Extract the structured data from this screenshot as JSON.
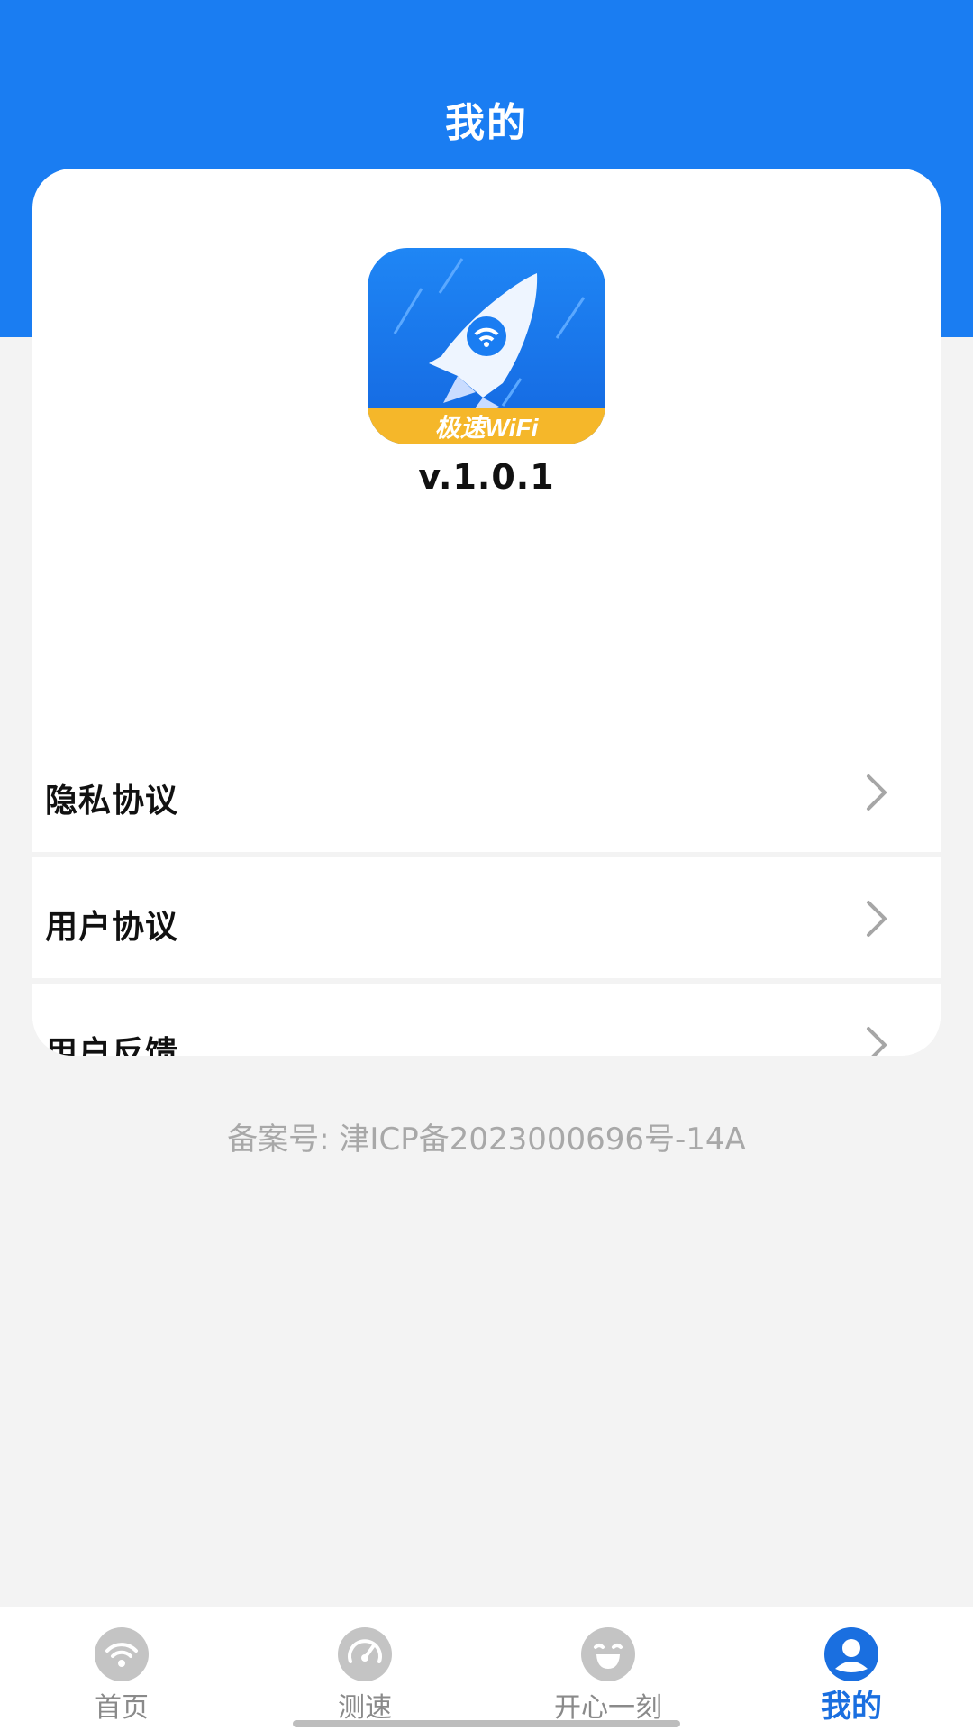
{
  "header": {
    "title": "我的"
  },
  "app": {
    "version": "v.1.0.1",
    "logo_text": "极速WiFi"
  },
  "menu": {
    "items": [
      {
        "label": "隐私协议",
        "icon": "chevron-right-icon"
      },
      {
        "label": "用户协议",
        "icon": "chevron-right-icon"
      },
      {
        "label": "用户反馈",
        "icon": "chevron-right-icon"
      }
    ]
  },
  "footer": {
    "icp": "备案号: 津ICP备2023000696号-14A"
  },
  "tabbar": {
    "active_index": 3,
    "items": [
      {
        "label": "首页",
        "icon": "wifi-icon"
      },
      {
        "label": "测速",
        "icon": "speedometer-icon"
      },
      {
        "label": "开心一刻",
        "icon": "laugh-face-icon"
      },
      {
        "label": "我的",
        "icon": "user-icon"
      }
    ]
  },
  "colors": {
    "primary": "#1a7df2",
    "active_tab": "#1a6fe0",
    "inactive_icon": "#c4c4c4",
    "logo_band": "#f5b72a"
  }
}
